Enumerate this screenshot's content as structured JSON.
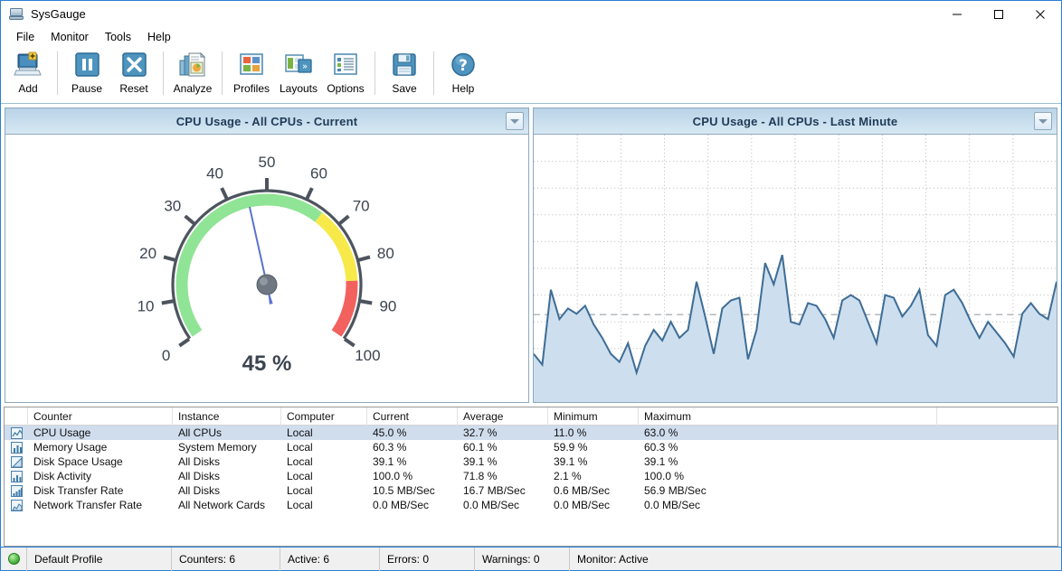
{
  "window": {
    "title": "SysGauge",
    "icon": "app-gauge-icon",
    "controls": {
      "minimize": "minimize-icon",
      "maximize": "maximize-icon",
      "close": "close-icon"
    },
    "accent": "#2a7fd4"
  },
  "menu": {
    "items": [
      "File",
      "Monitor",
      "Tools",
      "Help"
    ]
  },
  "toolbar": {
    "buttons": [
      {
        "label": "Add",
        "icon": "add-computer-icon"
      },
      {
        "label": "Pause",
        "icon": "pause-icon"
      },
      {
        "label": "Reset",
        "icon": "reset-x-icon"
      },
      {
        "label": "Analyze",
        "icon": "analyze-report-icon"
      },
      {
        "label": "Profiles",
        "icon": "profiles-grid-icon"
      },
      {
        "label": "Layouts",
        "icon": "layouts-windows-icon"
      },
      {
        "label": "Options",
        "icon": "options-list-icon"
      },
      {
        "label": "Save",
        "icon": "save-floppy-icon"
      },
      {
        "label": "Help",
        "icon": "help-question-icon"
      }
    ]
  },
  "panels": {
    "gauge_panel": {
      "title": "CPU Usage - All CPUs - Current",
      "dropdown_icon": "chevron-down-icon",
      "gauge": {
        "value": 45,
        "value_label": "45 %",
        "min": 0,
        "max": 100,
        "ticks": [
          "0",
          "10",
          "20",
          "30",
          "40",
          "50",
          "60",
          "70",
          "80",
          "90",
          "100"
        ],
        "bands": [
          {
            "from": 0,
            "to": 65,
            "color": "#90e495"
          },
          {
            "from": 65,
            "to": 85,
            "color": "#f7e94a"
          },
          {
            "from": 85,
            "to": 100,
            "color": "#f2615e"
          }
        ],
        "needle_color": "#5b74d0",
        "hub_color": "#6f7782"
      }
    },
    "chart_panel": {
      "title": "CPU Usage - All CPUs - Last Minute",
      "dropdown_icon": "chevron-down-icon"
    }
  },
  "chart_data": {
    "type": "area",
    "title": "CPU Usage - All CPUs - Last Minute",
    "xlabel": "",
    "ylabel": "",
    "ylim": [
      0,
      100
    ],
    "grid": true,
    "legend": false,
    "line_color": "#3f6d96",
    "fill_color": "#cddfee",
    "average_line": 32.7,
    "series": [
      {
        "name": "CPU Usage",
        "values": [
          18,
          14,
          42,
          31,
          35,
          33,
          36,
          29,
          24,
          18,
          15,
          22,
          11,
          21,
          27,
          23,
          30,
          24,
          27,
          45,
          32,
          18,
          35,
          38,
          39,
          16,
          27,
          52,
          44,
          55,
          30,
          29,
          37,
          36,
          31,
          24,
          38,
          40,
          38,
          30,
          22,
          40,
          39,
          32,
          36,
          42,
          25,
          21,
          40,
          42,
          37,
          30,
          24,
          30,
          26,
          22,
          17,
          33,
          37,
          33,
          31,
          45
        ]
      }
    ]
  },
  "table": {
    "columns": [
      "Counter",
      "Instance",
      "Computer",
      "Current",
      "Average",
      "Minimum",
      "Maximum"
    ],
    "rows": [
      {
        "icon": "line-chart-icon",
        "selected": true,
        "cells": [
          "CPU Usage",
          "All CPUs",
          "Local",
          "45.0 %",
          "32.7 %",
          "11.0 %",
          "63.0 %"
        ]
      },
      {
        "icon": "bar-chart-icon",
        "selected": false,
        "cells": [
          "Memory Usage",
          "System Memory",
          "Local",
          "60.3 %",
          "60.1 %",
          "59.9 %",
          "60.3 %"
        ]
      },
      {
        "icon": "area-chart-icon",
        "selected": false,
        "cells": [
          "Disk Space Usage",
          "All Disks",
          "Local",
          "39.1 %",
          "39.1 %",
          "39.1 %",
          "39.1 %"
        ]
      },
      {
        "icon": "column-chart-icon",
        "selected": false,
        "cells": [
          "Disk Activity",
          "All Disks",
          "Local",
          "100.0 %",
          "71.8 %",
          "2.1 %",
          "100.0 %"
        ]
      },
      {
        "icon": "step-chart-icon",
        "selected": false,
        "cells": [
          "Disk Transfer Rate",
          "All Disks",
          "Local",
          "10.5 MB/Sec",
          "16.7 MB/Sec",
          "0.6 MB/Sec",
          "56.9 MB/Sec"
        ]
      },
      {
        "icon": "wave-chart-icon",
        "selected": false,
        "cells": [
          "Network Transfer Rate",
          "All Network Cards",
          "Local",
          "0.0 MB/Sec",
          "0.0 MB/Sec",
          "0.0 MB/Sec",
          "0.0 MB/Sec"
        ]
      }
    ]
  },
  "statusbar": {
    "led": "status-led-green",
    "profile": "Default Profile",
    "counters": "Counters: 6",
    "active": "Active: 6",
    "errors": "Errors: 0",
    "warnings": "Warnings: 0",
    "monitor": "Monitor: Active"
  }
}
